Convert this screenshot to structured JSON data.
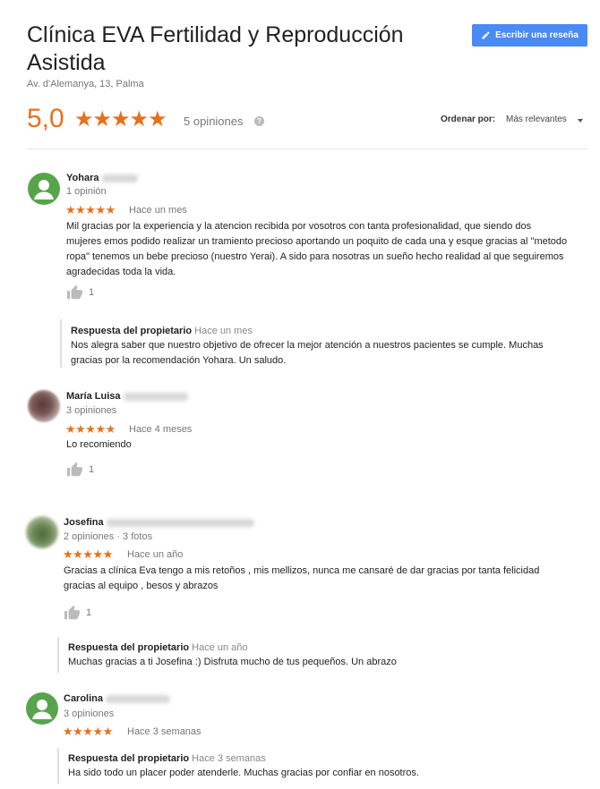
{
  "header": {
    "title": "Clínica EVA Fertilidad y Reproducción Asistida",
    "address": "Av. d'Alemanya, 13, Palma",
    "write_review_label": "Escribir una reseña",
    "rating": "5,0",
    "rating_stars": "★★★★★",
    "review_count": "5 opiniones",
    "sort_label": "Ordenar por:",
    "sort_value": "Más relevantes"
  },
  "reviews": [
    {
      "name": "Yohara",
      "meta": "1 opinión",
      "stars": "★★★★★",
      "time": "Hace un mes",
      "text": "Mil gracias por la experiencia y la atencion recibida por vosotros con tanta profesionalidad, que siendo dos mujeres emos podido realizar un tramiento precioso aportando un poquito de cada una y esque gracias al \"metodo ropa\" tenemos un bebe precioso (nuestro Yerai). A sido para nosotras un sueño hecho realidad al que seguiremos agradecidas toda la vida.",
      "likes": "1",
      "reply": {
        "title": "Respuesta del propietario",
        "time": "Hace un mes",
        "text": "Nos alegra saber que nuestro objetivo de ofrecer la mejor atención a nuestros pacientes se cumple. Muchas gracias por la recomendación Yohara. Un saludo."
      }
    },
    {
      "name": "María Luisa",
      "meta": "3 opiniones",
      "stars": "★★★★★",
      "time": "Hace 4 meses",
      "text": "Lo recomiendo",
      "likes": "1"
    },
    {
      "name": "Josefina",
      "meta": "2 opiniones · 3 fotos",
      "stars": "★★★★★",
      "time": "Hace un año",
      "text": "Gracias a clínica Eva tengo a mis retoños , mis mellizos, nunca me cansaré de dar gracias por tanta felicidad gracias al equipo , besos y abrazos",
      "likes": "1",
      "reply": {
        "title": "Respuesta del propietario",
        "time": "Hace un año",
        "text": "Muchas gracias a ti Josefina :) Disfruta mucho de tus pequeños. Un abrazo"
      }
    },
    {
      "name": "Carolina",
      "meta": "3 opiniones",
      "stars": "★★★★★",
      "time": "Hace 3 semanas",
      "reply": {
        "title": "Respuesta del propietario",
        "time": "Hace 3 semanas",
        "text": "Ha sido todo un placer poder atenderle. Muchas gracias por confiar en nosotros."
      }
    }
  ],
  "colors": {
    "star": "#e7711b",
    "button": "#4a8af4",
    "avatar_green": "#56a54b"
  }
}
